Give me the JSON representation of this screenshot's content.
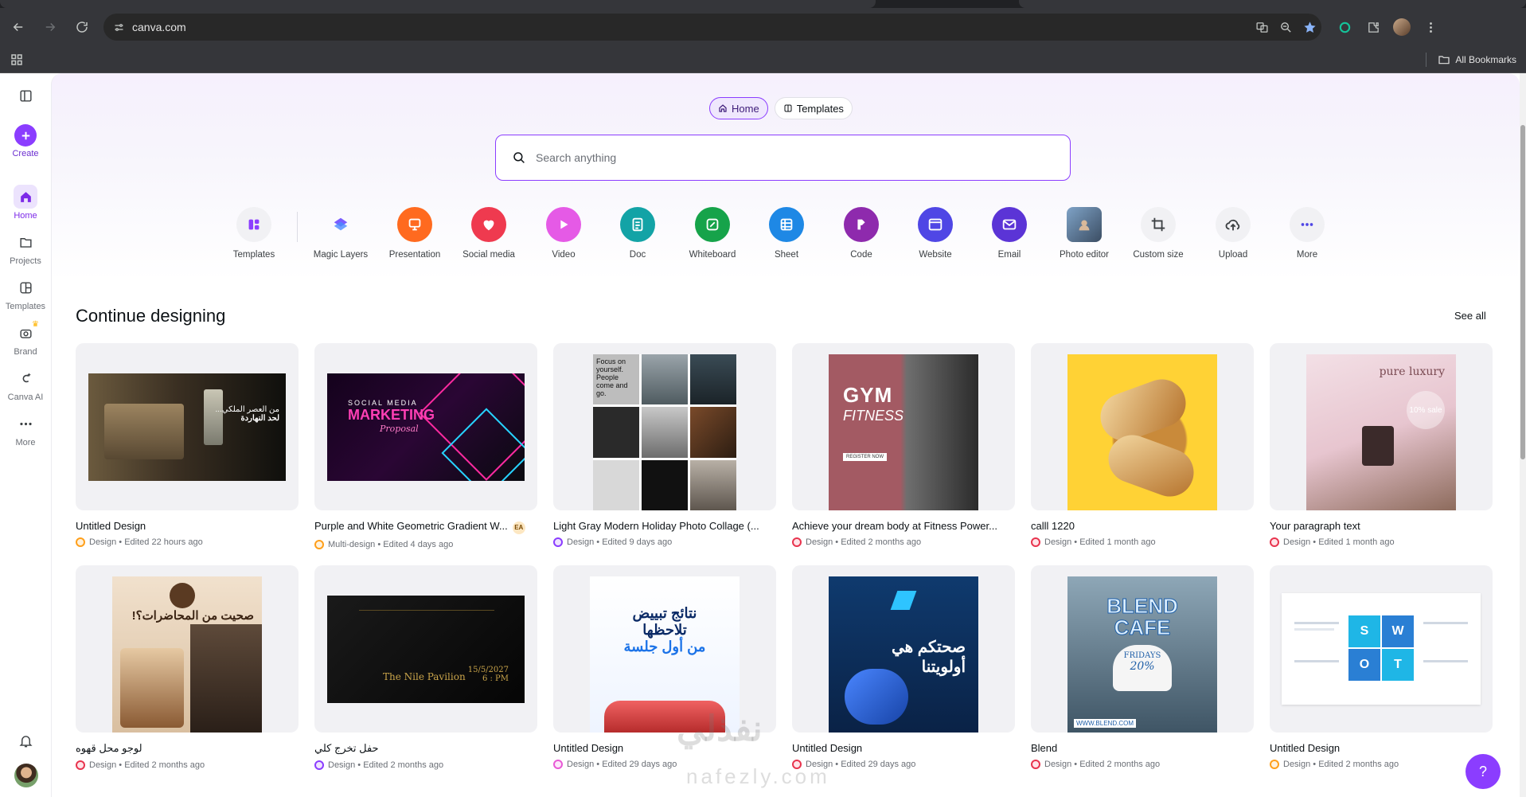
{
  "browser": {
    "url": "canva.com",
    "all_bookmarks": "All Bookmarks"
  },
  "sidebar": {
    "items": [
      {
        "label": "Create",
        "icon": "plus-icon"
      },
      {
        "label": "Home",
        "icon": "home-icon"
      },
      {
        "label": "Projects",
        "icon": "folder-icon"
      },
      {
        "label": "Templates",
        "icon": "templates-icon"
      },
      {
        "label": "Brand",
        "icon": "brand-icon"
      },
      {
        "label": "Canva AI",
        "icon": "canva-ai-icon"
      },
      {
        "label": "More",
        "icon": "more-icon"
      }
    ]
  },
  "top_tabs": {
    "home": "Home",
    "templates": "Templates"
  },
  "search": {
    "placeholder": "Search anything"
  },
  "categories": [
    {
      "label": "Templates",
      "color": "#f1f1f4",
      "icon": "templates-icon"
    },
    {
      "label": "Magic Layers",
      "color": "#ffffff",
      "icon": "magic-layers-icon"
    },
    {
      "label": "Presentation",
      "color": "#ff6a1f",
      "icon": "presentation-icon"
    },
    {
      "label": "Social media",
      "color": "#ef3a4f",
      "icon": "heart-icon"
    },
    {
      "label": "Video",
      "color": "#e55ae6",
      "icon": "video-icon"
    },
    {
      "label": "Doc",
      "color": "#13a3a6",
      "icon": "doc-icon"
    },
    {
      "label": "Whiteboard",
      "color": "#16a34a",
      "icon": "whiteboard-icon"
    },
    {
      "label": "Sheet",
      "color": "#1e88e5",
      "icon": "sheet-icon"
    },
    {
      "label": "Code",
      "color": "#8e2aad",
      "icon": "code-icon"
    },
    {
      "label": "Website",
      "color": "#4f46e5",
      "icon": "website-icon"
    },
    {
      "label": "Email",
      "color": "#5b34d6",
      "icon": "email-icon"
    },
    {
      "label": "Photo editor",
      "color": "#9bb1c7",
      "icon": "photo-editor-icon"
    },
    {
      "label": "Custom size",
      "color": "#f1f1f4",
      "icon": "custom-size-icon"
    },
    {
      "label": "Upload",
      "color": "#f1f1f4",
      "icon": "upload-icon"
    },
    {
      "label": "More",
      "color": "#f1f1f4",
      "icon": "more-icon"
    }
  ],
  "section": {
    "title": "Continue designing",
    "see_all": "See all"
  },
  "designs": [
    {
      "title": "Untitled Design",
      "type": "Design",
      "edited": "Edited 22 hours ago",
      "dot": "orange"
    },
    {
      "title": "Purple and White Geometric Gradient W...",
      "type": "Multi-design",
      "edited": "Edited 4 days ago",
      "dot": "orange",
      "badge": "EA"
    },
    {
      "title": "Light Gray Modern Holiday Photo Collage (...",
      "type": "Design",
      "edited": "Edited 9 days ago",
      "dot": "purple"
    },
    {
      "title": "Achieve your dream body at Fitness Power...",
      "type": "Design",
      "edited": "Edited 2 months ago",
      "dot": "red"
    },
    {
      "title": "calll 1220",
      "type": "Design",
      "edited": "Edited 1 month ago",
      "dot": "red"
    },
    {
      "title": "Your paragraph text",
      "type": "Design",
      "edited": "Edited 1 month ago",
      "dot": "red"
    },
    {
      "title": "لوجو محل قهوه",
      "type": "Design",
      "edited": "Edited 2 months ago",
      "dot": "red"
    },
    {
      "title": "حفل تخرج كلي",
      "type": "Design",
      "edited": "Edited 2 months ago",
      "dot": "purple"
    },
    {
      "title": "Untitled Design",
      "type": "Design",
      "edited": "Edited 29 days ago",
      "dot": "pink"
    },
    {
      "title": "Untitled Design",
      "type": "Design",
      "edited": "Edited 29 days ago",
      "dot": "red"
    },
    {
      "title": "Blend",
      "type": "Design",
      "edited": "Edited 2 months ago",
      "dot": "red"
    },
    {
      "title": "Untitled Design",
      "type": "Design",
      "edited": "Edited 2 months ago",
      "dot": "orange"
    }
  ],
  "thumb_text": {
    "t0_ar1": "من العصر الملكي...",
    "t0_ar2": "لحد النهاردة",
    "t1_l1": "SOCIAL MEDIA",
    "t1_l2": "MARKETING",
    "t1_l3": "Proposal",
    "t2_l1": "Focus on yourself. People come and go.",
    "t3_l1": "GYM",
    "t3_l2": "FITNESS",
    "t3_l3": "REGISTER NOW",
    "t5_l1": "pure luxury",
    "t5_l2": "10% sale",
    "t6_l1": "صحيت من المحاضرات؟!",
    "t7_l1": "The Nile Pavilion",
    "t7_l2": "15/5/2027",
    "t7_l3": "6 : PM",
    "t8_l1": "نتائج تبييض",
    "t8_l2": "تلاحظها",
    "t8_l3": "من أول جلسة",
    "t9_l1": "صحتكم هي",
    "t9_l2": "أولويتنا",
    "t10_l1": "BLEND",
    "t10_l2": "CAFE",
    "t10_l3": "FRIDAYS",
    "t10_l4": "20%",
    "t10_l5": "WWW.BLEND.COM",
    "t11_s": "S",
    "t11_w": "W",
    "t11_o": "O",
    "t11_t": "T"
  },
  "watermark": {
    "ar": "نفذلي",
    "en": "nafezly.com"
  },
  "help": "?"
}
